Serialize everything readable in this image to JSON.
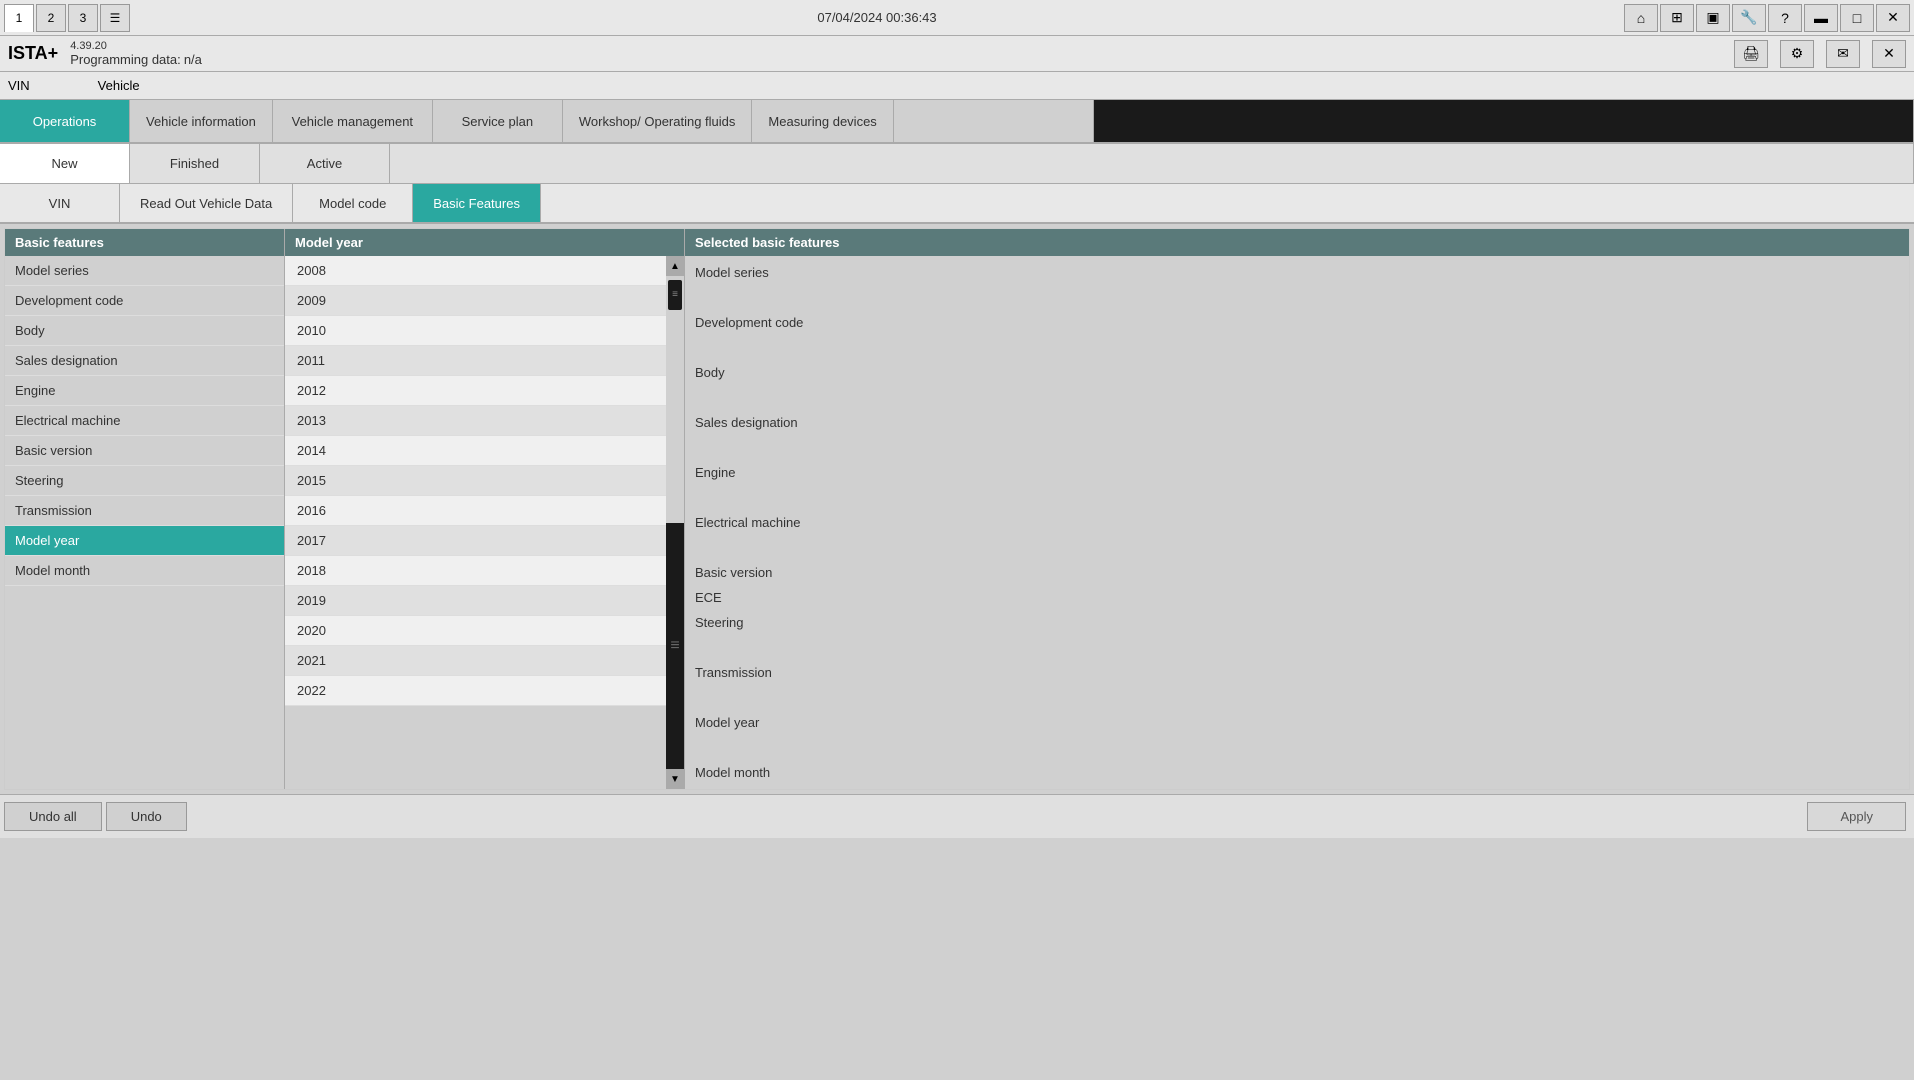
{
  "titlebar": {
    "tabs": [
      "1",
      "2",
      "3"
    ],
    "datetime": "07/04/2024 00:36:43",
    "icons": {
      "home": "🏠",
      "grid": "⊞",
      "camera": "📷",
      "wrench": "🔧",
      "question": "?",
      "monitor": "🖥",
      "expand": "⬜",
      "close": "✕"
    },
    "secondary_icons": {
      "print": "🖨",
      "settings": "⚙",
      "mail": "✉",
      "close2": "✕"
    }
  },
  "app": {
    "name": "ISTA+",
    "version": "4.39.20",
    "programming_label": "Programming data:",
    "programming_value": "n/a"
  },
  "header": {
    "vin_label": "VIN",
    "vehicle_label": "Vehicle"
  },
  "nav_tabs": [
    {
      "id": "operations",
      "label": "Operations",
      "active": true
    },
    {
      "id": "vehicle-info",
      "label": "Vehicle information",
      "active": false
    },
    {
      "id": "vehicle-mgmt",
      "label": "Vehicle management",
      "active": false
    },
    {
      "id": "service-plan",
      "label": "Service plan",
      "active": false
    },
    {
      "id": "workshop",
      "label": "Workshop/ Operating fluids",
      "active": false
    },
    {
      "id": "measuring",
      "label": "Measuring devices",
      "active": false
    },
    {
      "id": "blank1",
      "label": "",
      "active": false
    },
    {
      "id": "blank2",
      "label": "",
      "active": false
    }
  ],
  "sub_tabs": [
    {
      "id": "new",
      "label": "New",
      "active": true
    },
    {
      "id": "finished",
      "label": "Finished",
      "active": false
    },
    {
      "id": "active",
      "label": "Active",
      "active": false
    }
  ],
  "sub_tabs2": [
    {
      "id": "vin",
      "label": "VIN",
      "active": false
    },
    {
      "id": "read-out",
      "label": "Read Out Vehicle Data",
      "active": false
    },
    {
      "id": "model-code",
      "label": "Model code",
      "active": false
    },
    {
      "id": "basic-features",
      "label": "Basic Features",
      "active": true
    }
  ],
  "left_panel": {
    "header": "Basic features",
    "items": [
      {
        "id": "model-series",
        "label": "Model series",
        "selected": false
      },
      {
        "id": "development-code",
        "label": "Development code",
        "selected": false
      },
      {
        "id": "body",
        "label": "Body",
        "selected": false
      },
      {
        "id": "sales-designation",
        "label": "Sales designation",
        "selected": false
      },
      {
        "id": "engine",
        "label": "Engine",
        "selected": false
      },
      {
        "id": "electrical-machine",
        "label": "Electrical machine",
        "selected": false
      },
      {
        "id": "basic-version",
        "label": "Basic version",
        "selected": false
      },
      {
        "id": "steering",
        "label": "Steering",
        "selected": false
      },
      {
        "id": "transmission",
        "label": "Transmission",
        "selected": false
      },
      {
        "id": "model-year",
        "label": "Model year",
        "selected": true
      },
      {
        "id": "model-month",
        "label": "Model month",
        "selected": false
      }
    ]
  },
  "middle_panel": {
    "header": "Model year",
    "years": [
      "2008",
      "2009",
      "2010",
      "2011",
      "2012",
      "2013",
      "2014",
      "2015",
      "2016",
      "2017",
      "2018",
      "2019",
      "2020",
      "2021",
      "2022"
    ]
  },
  "right_panel": {
    "header": "Selected basic features",
    "items": [
      {
        "label": "Model series"
      },
      {
        "label": ""
      },
      {
        "label": "Development code"
      },
      {
        "label": ""
      },
      {
        "label": "Body"
      },
      {
        "label": ""
      },
      {
        "label": "Sales designation"
      },
      {
        "label": ""
      },
      {
        "label": "Engine"
      },
      {
        "label": ""
      },
      {
        "label": "Electrical machine"
      },
      {
        "label": ""
      },
      {
        "label": "Basic version"
      },
      {
        "label": "ECE"
      },
      {
        "label": "Steering"
      },
      {
        "label": ""
      },
      {
        "label": "Transmission"
      },
      {
        "label": ""
      },
      {
        "label": "Model year"
      },
      {
        "label": ""
      },
      {
        "label": "Model month"
      }
    ]
  },
  "bottom_bar": {
    "undo_all": "Undo all",
    "undo": "Undo",
    "apply": "Apply"
  }
}
